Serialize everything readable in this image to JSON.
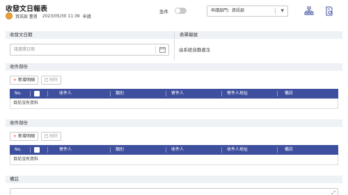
{
  "header": {
    "title": "收發文日報表",
    "user": "資訊部 董恩",
    "datetime": "2023/05/30 11:39",
    "status": "申請"
  },
  "toolbar": {
    "urgent_label": "急件",
    "dept_select_value": "申請部門：資訊部",
    "icons": [
      "org-chart-icon",
      "document-settings-icon"
    ]
  },
  "fields": {
    "date_label": "收發文日期",
    "date_placeholder": "請選擇日期",
    "form_no_label": "表單編號",
    "form_no_value": "由系統自動產生"
  },
  "received": {
    "section_label": "收件部份",
    "add_button": "新增明細",
    "delete_button": "刪除",
    "columns": [
      "No.",
      "",
      "收件人",
      "類別",
      "寄件人",
      "寄件人地址",
      "備註"
    ],
    "empty_text": "目前沒有資料"
  },
  "sent": {
    "section_label": "收件部份",
    "add_button": "新增明細",
    "delete_button": "刪除",
    "columns": [
      "No.",
      "",
      "寄件人",
      "類別",
      "收件人",
      "收件人地址",
      "備註"
    ],
    "empty_text": "目前沒有資料"
  },
  "notes": {
    "section_label": "備註"
  }
}
